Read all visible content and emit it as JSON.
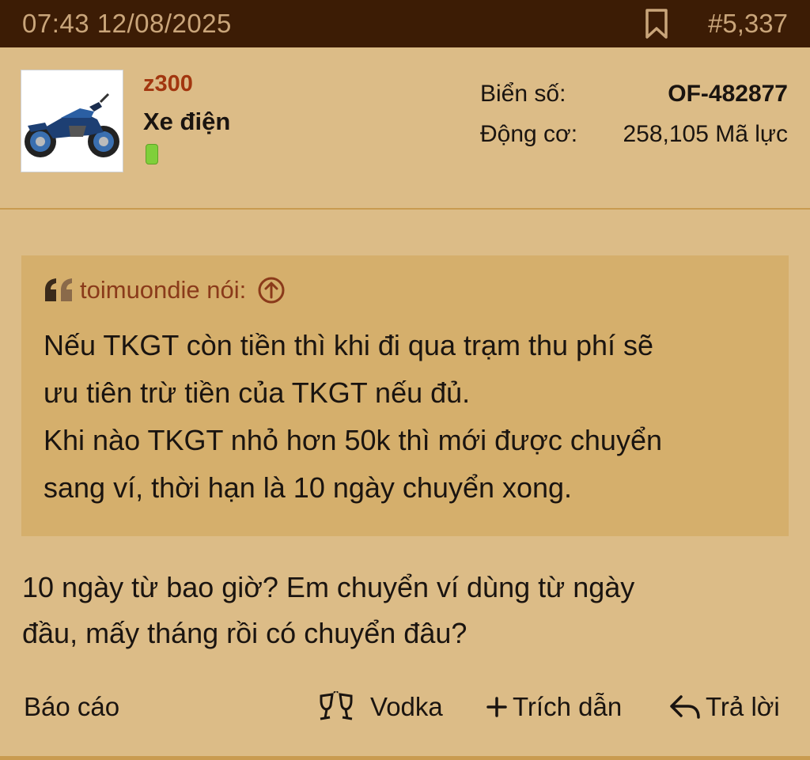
{
  "header": {
    "timestamp": "07:43 12/08/2025",
    "post_number": "#5,337",
    "bookmark_icon": "bookmark-icon"
  },
  "user": {
    "name": "z300",
    "title": "Xe điện",
    "online_status": "online",
    "avatar_icon": "motorcycle-avatar",
    "plate_label": "Biển số:",
    "plate_value": "OF-482877",
    "engine_label": "Động cơ:",
    "engine_value": "258,105 Mã lực"
  },
  "quote": {
    "author": "toimuondie nói:",
    "lines": [
      "Nếu TKGT còn tiền thì khi đi qua trạm thu phí sẽ",
      "ưu tiên trừ tiền của TKGT nếu đủ.",
      "Khi nào TKGT nhỏ hơn 50k thì mới được chuyển",
      "sang ví, thời hạn là 10 ngày chuyển xong."
    ]
  },
  "post": {
    "lines": [
      "10 ngày từ bao giờ? Em chuyển ví dùng từ ngày",
      "đầu, mấy tháng rồi có chuyển đâu?"
    ]
  },
  "actions": {
    "report": "Báo cáo",
    "vodka": "Vodka",
    "quote": "Trích dẫn",
    "reply": "Trả lời"
  },
  "colors": {
    "topbar": "#3c1c05",
    "background": "#dcbc87",
    "quote_bg": "#d5af6c",
    "username": "#a2360f",
    "meta_text": "#c9a57a"
  }
}
